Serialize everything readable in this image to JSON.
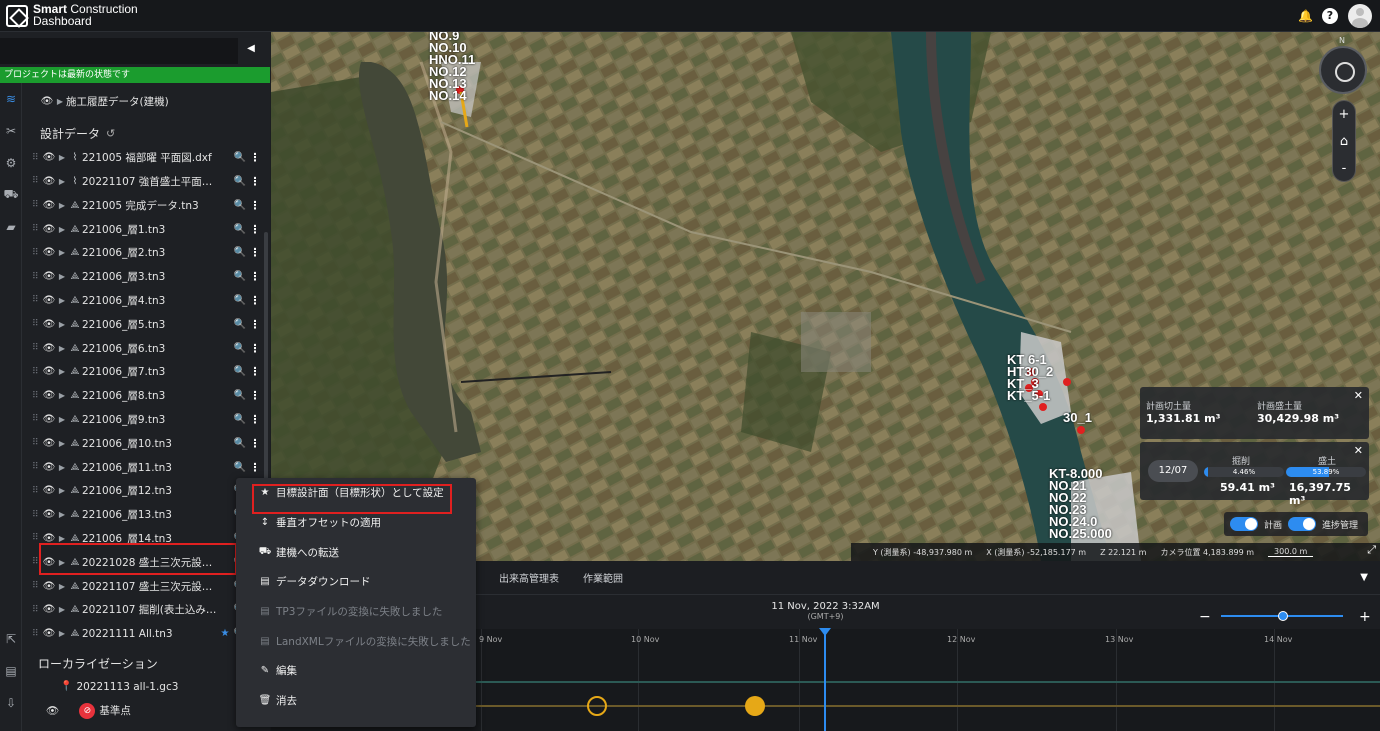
{
  "header": {
    "brand_bold": "Smart",
    "brand_rest": " Construction",
    "brand_line2": "Dashboard"
  },
  "sidebar": {
    "search_placeholder": "",
    "status": "プロジェクトは最新の状態です",
    "history_item": "施工履歴データ(建機)",
    "design_section": "設計データ",
    "files": [
      {
        "name": "221005 福部曜 平面図.dxf",
        "type": "dxf"
      },
      {
        "name": "20221107 強首盛土平面図....",
        "type": "dxf"
      },
      {
        "name": "221005 完成データ.tn3",
        "type": "tn3"
      },
      {
        "name": "221006_層1.tn3",
        "type": "tn3"
      },
      {
        "name": "221006_層2.tn3",
        "type": "tn3"
      },
      {
        "name": "221006_層3.tn3",
        "type": "tn3"
      },
      {
        "name": "221006_層4.tn3",
        "type": "tn3"
      },
      {
        "name": "221006_層5.tn3",
        "type": "tn3"
      },
      {
        "name": "221006_層6.tn3",
        "type": "tn3"
      },
      {
        "name": "221006_層7.tn3",
        "type": "tn3"
      },
      {
        "name": "221006_層8.tn3",
        "type": "tn3"
      },
      {
        "name": "221006_層9.tn3",
        "type": "tn3"
      },
      {
        "name": "221006_層10.tn3",
        "type": "tn3"
      },
      {
        "name": "221006_層11.tn3",
        "type": "tn3"
      },
      {
        "name": "221006_層12.tn3",
        "type": "tn3"
      },
      {
        "name": "221006_層13.tn3",
        "type": "tn3"
      },
      {
        "name": "221006_層14.tn3",
        "type": "tn3"
      },
      {
        "name": "20221028 盛土三次元設計...",
        "type": "tn3"
      },
      {
        "name": "20221107 盛土三次元設計...",
        "type": "tn3"
      },
      {
        "name": "20221107 掘削(表土込み)...",
        "type": "tn3"
      },
      {
        "name": "20221111 All.tn3",
        "type": "tn3",
        "starred": true
      }
    ],
    "localization_section": "ローカライゼーション",
    "localization_file": "20221113 all-1.gc3",
    "benchmark": "基準点"
  },
  "context_menu": {
    "items": [
      {
        "label": "目標設計面（目標形状）として設定",
        "icon": "★",
        "disabled": false
      },
      {
        "label": "垂直オフセットの適用",
        "icon": "↕",
        "disabled": false
      },
      {
        "label": "建機への転送",
        "icon": "⛟",
        "disabled": false
      },
      {
        "label": "データダウンロード",
        "icon": "▤",
        "disabled": false
      },
      {
        "label": "TP3ファイルの変換に失敗しました",
        "icon": "▤",
        "disabled": true
      },
      {
        "label": "LandXMLファイルの変換に失敗しました",
        "icon": "▤",
        "disabled": true
      },
      {
        "label": "編集",
        "icon": "✎",
        "disabled": false
      },
      {
        "label": "消去",
        "icon": "🗑",
        "disabled": false
      }
    ]
  },
  "map": {
    "labels_top": [
      "NO.9",
      "NO.10",
      "HNO.11",
      "NO.12",
      "NO.13",
      "NO.14"
    ],
    "labels_mid": [
      "KT 6-1",
      "HT30_2",
      "KT_3",
      "KT_5-1",
      "30_1"
    ],
    "labels_low": [
      "KT-8.000",
      "NO.21",
      "NO.22",
      "NO.23",
      "NO.24.0",
      "NO.25.000"
    ],
    "compass_n": "N",
    "zoom_in": "+",
    "zoom_out": "-",
    "plan_volume": {
      "cut_label": "計画切土量",
      "cut_value": "1,331.81 m³",
      "fill_label": "計画盛土量",
      "fill_value": "30,429.98 m³"
    },
    "progress": {
      "date": "12/07",
      "excavation_label": "掘削",
      "excavation_pct": "4.46%",
      "excavation_value": "59.41 m³",
      "excavation_frac": 0.0446,
      "fill_label": "盛土",
      "fill_pct": "53.89%",
      "fill_value": "16,397.75 m³",
      "fill_frac": 0.5389
    },
    "toggles": {
      "plan": "計画",
      "progress": "進捗管理"
    },
    "coords": {
      "y": "Y (測量系) -48,937.980 m",
      "x": "X (測量系) -52,185.177 m",
      "z": "Z 22.121 m",
      "camera": "カメラ位置 4,183.899 m",
      "scale": "300.0 m"
    }
  },
  "bottom": {
    "tabs": [
      "出来高管理表",
      "作業範囲"
    ],
    "current_time": "11 Nov, 2022 3:32AM",
    "timezone": "(GMT+9)",
    "ticks": [
      "9 Nov",
      "10 Nov",
      "11 Nov",
      "12 Nov",
      "13 Nov",
      "14 Nov"
    ]
  },
  "colors": {
    "accent": "#2d8cf0",
    "status_green": "#1b9c2e",
    "highlight_red": "#e02020",
    "event_orange": "#e6a817"
  }
}
